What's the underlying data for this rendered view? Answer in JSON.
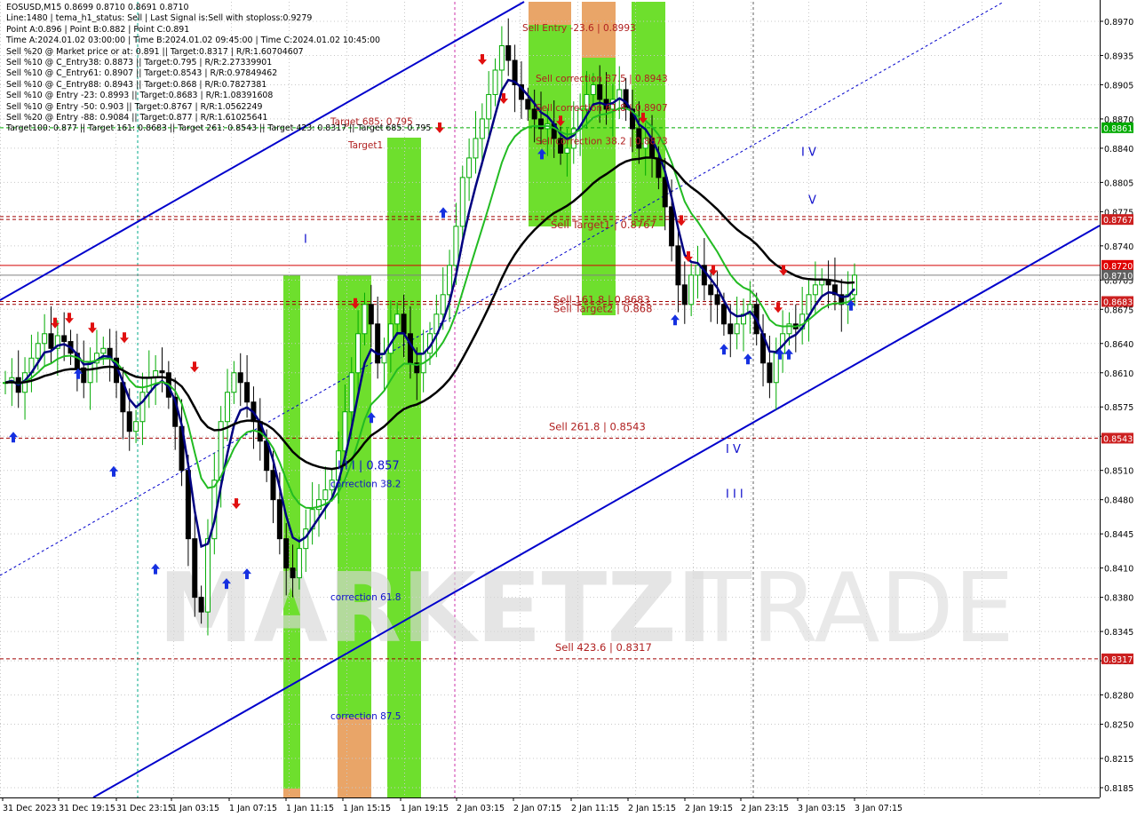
{
  "symbol": "EOSUSD,M15",
  "ohlc": "0.8699 0.8710 0.8691 0.8710",
  "info_lines": [
    "EOSUSD,M15  0.8699 0.8710 0.8691 0.8710",
    "Line:1480  | tema_h1_status: Sell | Last Signal is:Sell with stoploss:0.9279",
    "Point A:0.896 | Point B:0.882 | Point C:0.891",
    "Time A:2024.01.02 03:00:00 | Time B:2024.01.02 09:45:00 | Time C:2024.01.02 10:45:00",
    "Sell %20 @ Market price or at: 0.891 || Target:0.8317 | R/R:1.60704607",
    "Sell %10 @ C_Entry38: 0.8873 || Target:0.795 | R/R:2.27339901",
    "Sell %10 @ C_Entry61: 0.8907 || Target:0.8543 | R/R:0.97849462",
    "Sell %10 @ C_Entry88: 0.8943 || Target:0.868 | R/R:0.7827381",
    "Sell %10 @ Entry -23: 0.8993 || Target:0.8683 | R/R:1.08391608",
    "Sell %10 @ Entry -50: 0.903 || Target:0.8767 | R/R:1.0562249",
    "Sell %20 @ Entry -88: 0.9084 || Target:0.877 | R/R:1.61025641",
    "Target100: 0.877 || Target 161: 0.8683 || Target 261: 0.8543 || Target 423: 0.8317 || Target 685: 0.795"
  ],
  "watermark": "MARKETZITRADE",
  "watermark_parts": [
    "MARKETZI",
    "TRADE"
  ],
  "colors": {
    "background": "#ffffff",
    "grid": "#c8c8c8",
    "bull_candle": "#00aa00",
    "bear_candle": "#000000",
    "ema_fast": "#000080",
    "ema_slow": "#22bb22",
    "ema_long": "#000000",
    "channel": "#0000cc",
    "resistance": "#d40000",
    "dashed_level": "#a00000",
    "green_zone": "#66dd22",
    "orange_zone": "#e8a060",
    "label_red": "#b02020",
    "label_blue": "#1010cc",
    "up_arrow": "#1530e0",
    "down_arrow": "#e01010"
  },
  "chart_data": {
    "type": "candlestick",
    "y_axis": {
      "range": [
        0.8175,
        0.899
      ],
      "ticks": [
        "0.8970",
        "0.8935",
        "0.8905",
        "0.8870",
        "0.8840",
        "0.8805",
        "0.8775",
        "0.8740",
        "0.8705",
        "0.8675",
        "0.8640",
        "0.8610",
        "0.8575",
        "0.8545",
        "0.8510",
        "0.8480",
        "0.8445",
        "0.8410",
        "0.8380",
        "0.8345",
        "0.8315",
        "0.8280",
        "0.8250",
        "0.8215",
        "0.8185"
      ],
      "tick_values": [
        0.897,
        0.8935,
        0.8905,
        0.887,
        0.884,
        0.8805,
        0.8775,
        0.874,
        0.8705,
        0.8675,
        0.864,
        0.861,
        0.8575,
        0.8545,
        0.851,
        0.848,
        0.8445,
        0.841,
        0.838,
        0.8345,
        0.8315,
        0.828,
        0.825,
        0.8215,
        0.8185
      ]
    },
    "x_axis": {
      "labels": [
        "31 Dec 2023",
        "31 Dec 19:15",
        "31 Dec 23:15",
        "1 Jan 03:15",
        "1 Jan 07:15",
        "1 Jan 11:15",
        "1 Jan 15:15",
        "1 Jan 19:15",
        "2 Jan 03:15",
        "2 Jan 07:15",
        "2 Jan 11:15",
        "2 Jan 15:15",
        "2 Jan 19:15",
        "2 Jan 23:15",
        "3 Jan 03:15",
        "3 Jan 07:15"
      ]
    },
    "price_badges": [
      {
        "label": "0.8861",
        "value": 0.8861,
        "color": "#00aa00"
      },
      {
        "label": "0.8767",
        "value": 0.8767,
        "color": "#cc2020"
      },
      {
        "label": "0.8720",
        "value": 0.872,
        "color": "#e00000"
      },
      {
        "label": "0.8710",
        "value": 0.871,
        "color": "#606060"
      },
      {
        "label": "0.8683",
        "value": 0.8683,
        "color": "#cc2020"
      },
      {
        "label": "0.8543",
        "value": 0.8543,
        "color": "#cc2020"
      },
      {
        "label": "0.8317",
        "value": 0.8317,
        "color": "#cc2020"
      }
    ],
    "levels": [
      {
        "name": "target-861",
        "value": 0.8861,
        "style": "dashed",
        "color": "#00aa00"
      },
      {
        "name": "target-767",
        "value": 0.8767,
        "style": "dashed",
        "color": "#a00000"
      },
      {
        "name": "target-770",
        "value": 0.877,
        "style": "dashed",
        "color": "#a00000"
      },
      {
        "name": "resistance",
        "value": 0.872,
        "style": "solid",
        "color": "#d40000"
      },
      {
        "name": "current",
        "value": 0.871,
        "style": "solid",
        "color": "#808080"
      },
      {
        "name": "target-683",
        "value": 0.8683,
        "style": "dashed",
        "color": "#a00000"
      },
      {
        "name": "target-680",
        "value": 0.868,
        "style": "dashed",
        "color": "#a00000"
      },
      {
        "name": "target-543",
        "value": 0.8543,
        "style": "dashed",
        "color": "#a00000"
      },
      {
        "name": "target-317",
        "value": 0.8317,
        "style": "dashed",
        "color": "#a00000"
      }
    ],
    "level_labels": [
      {
        "text": "Sell  261.8 | 0.8543",
        "value": 0.8551
      },
      {
        "text": "Sell  423.6 | 0.8317",
        "value": 0.8325
      },
      {
        "text": "Sell Target1 | 0.8767",
        "value": 0.8758
      },
      {
        "text": "Sell Target2 | 0.868",
        "value": 0.8672
      },
      {
        "text": "Sell 161.8 | 0.8683",
        "value": 0.8681
      }
    ],
    "zone_labels": [
      {
        "text": "Sell Entry -23.6 | 0.8993",
        "color": "#b02020",
        "value": 0.896
      },
      {
        "text": "Sell correction 87.5 | 0.8943",
        "color": "#b02020",
        "value": 0.8908
      },
      {
        "text": "Sell correction 61.8 | 0.8907",
        "color": "#b02020",
        "value": 0.8878
      },
      {
        "text": "Sell correction 38.2 | 0.8873",
        "color": "#b02020",
        "value": 0.8844
      },
      {
        "text": "Target1",
        "color": "#b02020",
        "value": 0.884
      },
      {
        "text": "Target 685: 0.795",
        "color": "#b02020",
        "value": 0.8864
      },
      {
        "text": "correction 38.2",
        "color": "#1010cc",
        "value": 0.8493
      },
      {
        "text": "correction 61.8",
        "color": "#1010cc",
        "value": 0.8377
      },
      {
        "text": "correction 87.5",
        "color": "#1010cc",
        "value": 0.8255
      }
    ],
    "wave_labels": [
      {
        "text": "I",
        "value": 0.8743
      },
      {
        "text": "I I I | 0.857",
        "value": 0.8511
      },
      {
        "text": "I V",
        "value": 0.8832
      },
      {
        "text": "V",
        "value": 0.8783
      },
      {
        "text": "I V",
        "value": 0.8528
      },
      {
        "text": "I I I",
        "value": 0.8482
      }
    ],
    "close_series": [
      0.86,
      0.8605,
      0.859,
      0.861,
      0.8625,
      0.864,
      0.865,
      0.8635,
      0.8648,
      0.8642,
      0.863,
      0.8615,
      0.86,
      0.862,
      0.863,
      0.8635,
      0.8625,
      0.86,
      0.857,
      0.855,
      0.856,
      0.859,
      0.8605,
      0.8612,
      0.861,
      0.8585,
      0.8555,
      0.851,
      0.844,
      0.838,
      0.8365,
      0.844,
      0.85,
      0.856,
      0.859,
      0.861,
      0.86,
      0.858,
      0.856,
      0.854,
      0.851,
      0.848,
      0.844,
      0.841,
      0.84,
      0.843,
      0.845,
      0.847,
      0.848,
      0.849,
      0.85,
      0.853,
      0.857,
      0.861,
      0.865,
      0.868,
      0.866,
      0.862,
      0.863,
      0.866,
      0.867,
      0.865,
      0.862,
      0.861,
      0.863,
      0.865,
      0.867,
      0.869,
      0.872,
      0.876,
      0.881,
      0.883,
      0.885,
      0.887,
      0.8895,
      0.892,
      0.8945,
      0.893,
      0.8905,
      0.889,
      0.888,
      0.887,
      0.886,
      0.8865,
      0.885,
      0.8835,
      0.884,
      0.886,
      0.888,
      0.8895,
      0.8905,
      0.889,
      0.888,
      0.889,
      0.89,
      0.888,
      0.886,
      0.884,
      0.885,
      0.883,
      0.881,
      0.878,
      0.874,
      0.87,
      0.868,
      0.871,
      0.872,
      0.87,
      0.869,
      0.868,
      0.866,
      0.865,
      0.866,
      0.867,
      0.868,
      0.865,
      0.862,
      0.86,
      0.863,
      0.865,
      0.866,
      0.8655,
      0.867,
      0.869,
      0.87,
      0.8705,
      0.87,
      0.869,
      0.868,
      0.869,
      0.871
    ]
  }
}
